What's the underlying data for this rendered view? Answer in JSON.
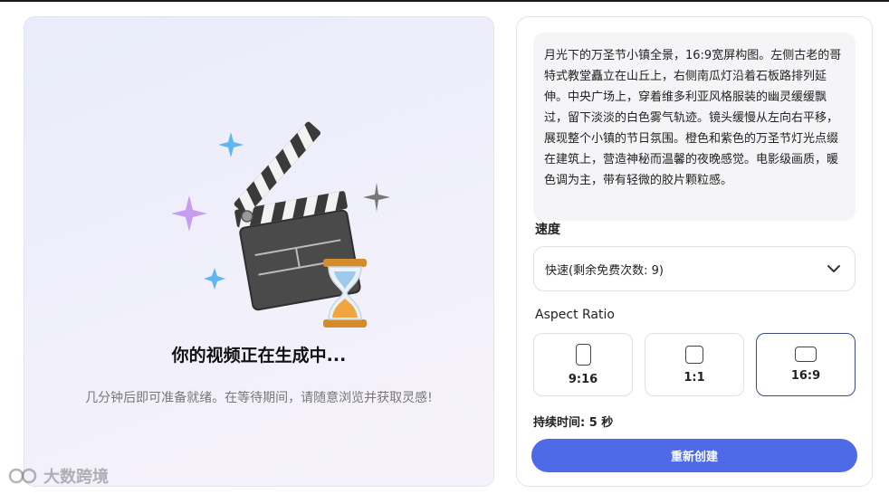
{
  "preview": {
    "status_title": "你的视频正在生成中...",
    "status_subtitle": "几分钟后即可准备就绪。在等待期间，请随意浏览并获取灵感!",
    "illustration_icons": [
      "clapperboard-icon",
      "hourglass-icon",
      "sparkle-icon"
    ],
    "watermark": "大数跨境"
  },
  "settings": {
    "prompt": "月光下的万圣节小镇全景，16:9宽屏构图。左侧古老的哥特式教堂矗立在山丘上，右侧南瓜灯沿着石板路排列延伸。中央广场上，穿着维多利亚风格服装的幽灵缓缓飘过，留下淡淡的白色雾气轨迹。镜头缓慢从左向右平移，展现整个小镇的节日氛围。橙色和紫色的万圣节灯光点缀在建筑上，营造神秘而温馨的夜晚感觉。电影级画质，暖色调为主，带有轻微的胶片颗粒感。",
    "speed_label": "速度",
    "speed_value": "快速(剩余免费次数: 9)",
    "aspect_ratio_label": "Aspect Ratio",
    "aspect_ratios": [
      {
        "label": "9:16",
        "selected": false
      },
      {
        "label": "1:1",
        "selected": false
      },
      {
        "label": "16:9",
        "selected": true
      }
    ],
    "duration_text": "持续时间: 5 秒",
    "recreate_button": "重新创建"
  },
  "colors": {
    "accent": "#4e6ae6",
    "selected_border": "#3c4a86",
    "preview_bg": "#eceefa"
  }
}
